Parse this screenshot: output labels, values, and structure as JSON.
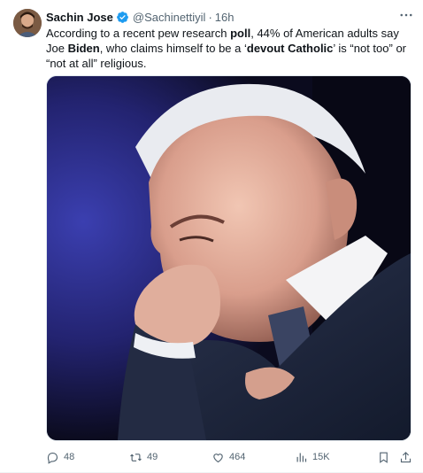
{
  "tweet": {
    "author_name": "Sachin Jose",
    "handle": "@Sachinettiyil",
    "separator": "·",
    "time": "16h",
    "text": {
      "p1": "According to a recent pew research ",
      "b1": "poll",
      "p2": ", 44% of American adults say Joe ",
      "b2": "Biden",
      "p3": ", who claims himself to be a ‘",
      "b3": "devout Catholic",
      "p4": "’ is “not too” or “not at all” religious."
    },
    "media_icon": "photo",
    "stats": {
      "replies": "48",
      "reposts": "49",
      "likes": "464",
      "views": "15K"
    }
  },
  "icons": {
    "verified": "verified-badge-icon",
    "more": "more-icon",
    "reply": "reply-icon",
    "repost": "repost-icon",
    "like": "heart-icon",
    "views": "views-icon",
    "bookmark": "bookmark-icon",
    "share": "share-icon"
  },
  "colors": {
    "accent": "#1d9bf0",
    "secondary_text": "#536471",
    "text": "#0f1419"
  }
}
